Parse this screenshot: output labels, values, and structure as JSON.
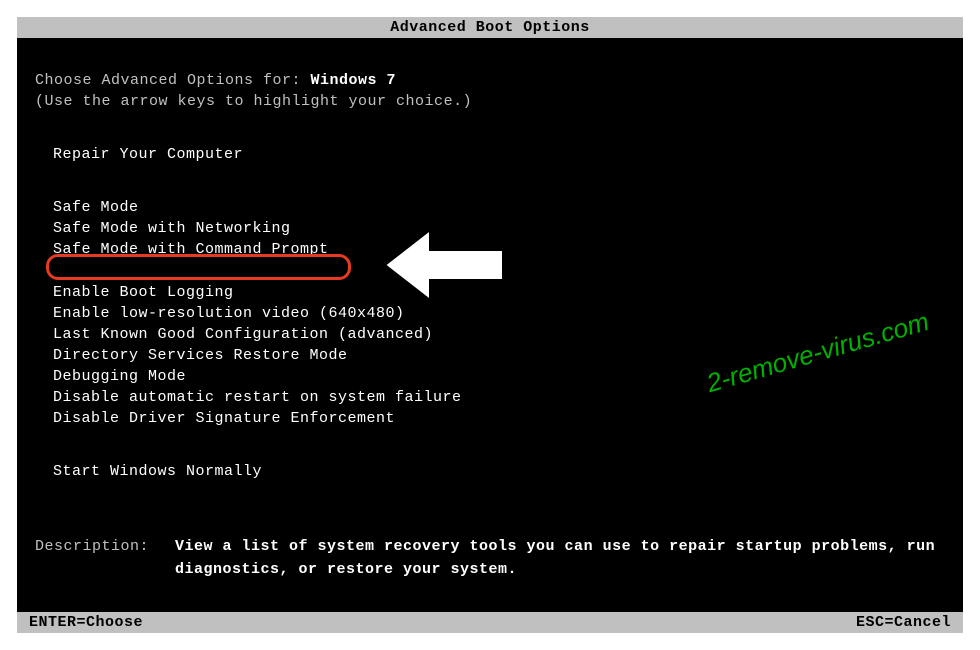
{
  "title": "Advanced Boot Options",
  "intro": {
    "line1_prefix": "Choose Advanced Options for: ",
    "os_name": "Windows 7",
    "line2": "(Use the arrow keys to highlight your choice.)"
  },
  "groups": {
    "repair": "Repair Your Computer",
    "safe1": "Safe Mode",
    "safe2": "Safe Mode with Networking",
    "safe3": "Safe Mode with Command Prompt",
    "adv1": "Enable Boot Logging",
    "adv2": "Enable low-resolution video (640x480)",
    "adv3": "Last Known Good Configuration (advanced)",
    "adv4": "Directory Services Restore Mode",
    "adv5": "Debugging Mode",
    "adv6": "Disable automatic restart on system failure",
    "adv7": "Disable Driver Signature Enforcement",
    "normal": "Start Windows Normally"
  },
  "description": {
    "label": "Description:",
    "text": "View a list of system recovery tools you can use to repair startup problems, run diagnostics, or restore your system."
  },
  "footer": {
    "enter": "ENTER=Choose",
    "esc": "ESC=Cancel"
  },
  "watermark": "2-remove-virus.com",
  "annotation": {
    "highlight_color": "#e63a23"
  }
}
